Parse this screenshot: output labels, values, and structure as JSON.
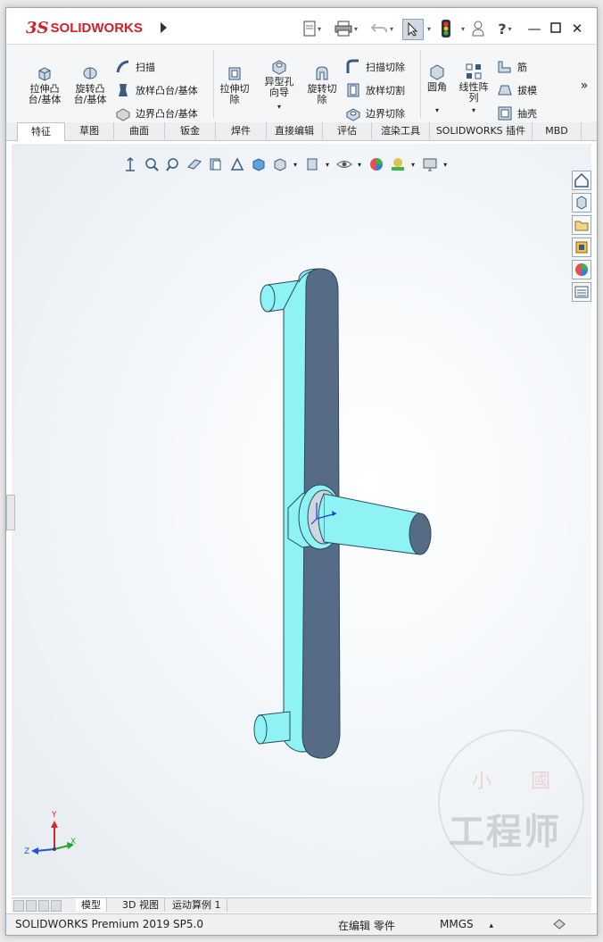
{
  "app": {
    "logo_prefix": "3S",
    "logo_name": "SOLIDWORKS"
  },
  "ribbon": {
    "col1": [
      {
        "label": "拉伸凸\n台/基体",
        "icon": "extrude-boss-icon"
      },
      {
        "label": "旋转凸\n台/基体",
        "icon": "revolve-boss-icon"
      }
    ],
    "col2": [
      {
        "label": "扫描",
        "icon": "sweep-icon"
      },
      {
        "label": "放样凸台/基体",
        "icon": "loft-icon"
      },
      {
        "label": "边界凸台/基体",
        "icon": "boundary-boss-icon"
      }
    ],
    "col3": [
      {
        "label": "拉伸切\n除",
        "icon": "extrude-cut-icon"
      },
      {
        "label": "异型孔\n向导",
        "icon": "hole-wizard-icon"
      },
      {
        "label": "旋转切\n除",
        "icon": "revolve-cut-icon"
      }
    ],
    "col4": [
      {
        "label": "扫描切除",
        "icon": "swept-cut-icon"
      },
      {
        "label": "放样切割",
        "icon": "lofted-cut-icon"
      },
      {
        "label": "边界切除",
        "icon": "boundary-cut-icon"
      }
    ],
    "col5": [
      {
        "label": "圆角",
        "icon": "fillet-icon"
      },
      {
        "label": "线性阵\n列",
        "icon": "linear-pattern-icon"
      }
    ],
    "col6": [
      {
        "label": "筋",
        "icon": "rib-icon"
      },
      {
        "label": "拔模",
        "icon": "draft-icon"
      },
      {
        "label": "抽壳",
        "icon": "shell-icon"
      }
    ],
    "more": "»"
  },
  "tabs": [
    {
      "label": "特征",
      "active": true
    },
    {
      "label": "草图"
    },
    {
      "label": "曲面"
    },
    {
      "label": "钣金"
    },
    {
      "label": "焊件"
    },
    {
      "label": "直接编辑"
    },
    {
      "label": "评估"
    },
    {
      "label": "渲染工具"
    },
    {
      "label": "SOLIDWORKS 插件"
    },
    {
      "label": "MBD"
    }
  ],
  "triad": {
    "x": "X",
    "y": "Y",
    "z": "Z"
  },
  "bottom_tabs": [
    {
      "label": "模型",
      "active": true
    },
    {
      "label": "3D 视图"
    },
    {
      "label": "运动算例 1"
    }
  ],
  "status": {
    "product": "SOLIDWORKS Premium 2019 SP5.0",
    "mode": "在编辑 零件",
    "units": "MMGS",
    "units_arrow": "▴"
  },
  "watermark": {
    "top_left": "小",
    "top_right": "國",
    "main": "工程师"
  },
  "colors": {
    "brand_red": "#d51f26",
    "part_face": "#8ff2f5",
    "part_shadow": "#566b85"
  }
}
